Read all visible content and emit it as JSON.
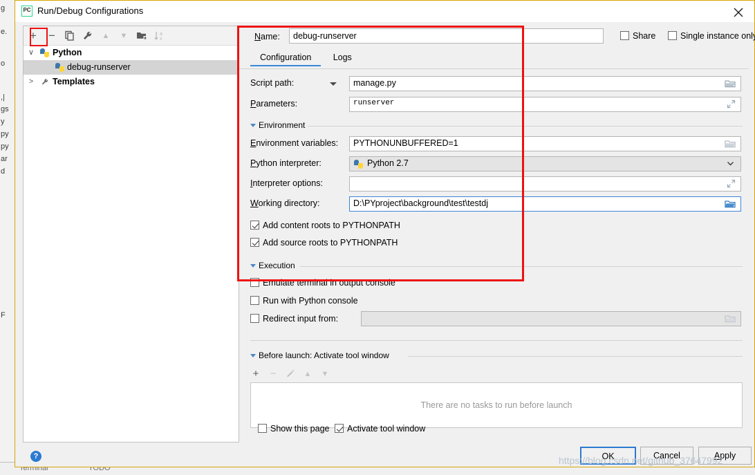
{
  "window": {
    "title": "Run/Debug Configurations",
    "app_icon": "pycharm-icon",
    "close_icon": "close-icon"
  },
  "background": {
    "left_fragments": [
      "g",
      "e.",
      "o",
      ",|",
      "gs",
      "y",
      "py",
      "py",
      "ar",
      "d",
      "F"
    ],
    "bottom_fragments": [
      "Terminal",
      "TODO"
    ]
  },
  "left_panel": {
    "toolbar": [
      {
        "name": "add-configuration-button",
        "glyph": "+",
        "dim": false,
        "highlighted": true
      },
      {
        "name": "remove-configuration-button",
        "glyph": "−",
        "dim": false,
        "highlighted": false
      },
      {
        "name": "copy-configuration-button",
        "glyph": "❐",
        "dim": false,
        "highlighted": false
      },
      {
        "name": "edit-templates-button",
        "glyph": "ὒ7",
        "dim": false,
        "highlighted": false
      },
      {
        "name": "move-up-button",
        "glyph": "▲",
        "dim": true,
        "highlighted": false
      },
      {
        "name": "move-down-button",
        "glyph": "▼",
        "dim": true,
        "highlighted": false
      },
      {
        "name": "new-folder-button",
        "glyph": "Ὄ1",
        "dim": false,
        "highlighted": false
      },
      {
        "name": "sort-alphabetically-button",
        "glyph": "⇣az",
        "dim": true,
        "highlighted": false
      }
    ],
    "tree": [
      {
        "label": "Python",
        "icon": "python-icon",
        "twisty": "∨",
        "depth": 0,
        "bold": true,
        "selected": false
      },
      {
        "label": "debug-runserver",
        "icon": "python-icon",
        "twisty": "",
        "depth": 1,
        "bold": false,
        "selected": true
      },
      {
        "label": "Templates",
        "icon": "wrench-icon",
        "twisty": ">",
        "depth": 0,
        "bold": true,
        "selected": false
      }
    ]
  },
  "right_panel": {
    "name_label": "Name:",
    "name_value": "debug-runserver",
    "share": {
      "label": "Share",
      "checked": false
    },
    "single_instance": {
      "label": "Single instance only",
      "checked": false
    },
    "tabs": [
      {
        "label": "Configuration",
        "active": true
      },
      {
        "label": "Logs",
        "active": false
      }
    ],
    "fields": [
      {
        "name": "script-path",
        "label": "Script path:",
        "value": "manage.py",
        "has_dropdown": true,
        "trailing_icon": "folder-browse-icon",
        "style": "normal"
      },
      {
        "name": "parameters",
        "label": "Parameters:",
        "value": "runserver",
        "has_dropdown": false,
        "trailing_icon": "expand-editor-icon",
        "style": "mono"
      },
      {
        "name": "environment-variables",
        "label": "Environment variables:",
        "value": "PYTHONUNBUFFERED=1",
        "has_dropdown": false,
        "trailing_icon": "folder-browse-icon",
        "style": "normal"
      },
      {
        "name": "python-interpreter",
        "label": "Python interpreter:",
        "value": "Python 2.7",
        "has_dropdown": false,
        "trailing_icon": "chevron-down-icon",
        "style": "grey",
        "value_icon": "python-icon"
      },
      {
        "name": "interpreter-options",
        "label": "Interpreter options:",
        "value": "",
        "has_dropdown": false,
        "trailing_icon": "expand-editor-icon",
        "style": "normal"
      },
      {
        "name": "working-directory",
        "label": "Working directory:",
        "value": "D:\\PYproject\\background\\test\\testdj",
        "has_dropdown": false,
        "trailing_icon": "folder-browse-icon",
        "style": "focus"
      }
    ],
    "sections": {
      "environment": "Environment",
      "execution": "Execution",
      "before_launch": "Before launch: Activate tool window"
    },
    "path_checkboxes": [
      {
        "name": "add-content-roots",
        "label": "Add content roots to PYTHONPATH",
        "checked": true
      },
      {
        "name": "add-source-roots",
        "label": "Add source roots to PYTHONPATH",
        "checked": true
      }
    ],
    "execution_checkboxes": [
      {
        "name": "emulate-terminal",
        "label": "Emulate terminal in output console",
        "checked": false
      },
      {
        "name": "run-with-python-console",
        "label": "Run with Python console",
        "checked": false
      },
      {
        "name": "redirect-input-from",
        "label": "Redirect input from:",
        "checked": false,
        "has_field": true,
        "field_value": ""
      }
    ],
    "before_launch": {
      "toolbar": [
        {
          "name": "add-task-button",
          "glyph": "+",
          "dim": false
        },
        {
          "name": "remove-task-button",
          "glyph": "−",
          "dim": true
        },
        {
          "name": "edit-task-button",
          "glyph": "✎",
          "dim": true
        },
        {
          "name": "move-task-up-button",
          "glyph": "▲",
          "dim": true
        },
        {
          "name": "move-task-down-button",
          "glyph": "▼",
          "dim": true
        }
      ],
      "empty_text": "There are no tasks to run before launch"
    },
    "footer_checkboxes": [
      {
        "name": "show-this-page",
        "label": "Show this page",
        "checked": false
      },
      {
        "name": "activate-tool-window",
        "label": "Activate tool window",
        "checked": true
      }
    ]
  },
  "buttons": {
    "ok": "OK",
    "cancel": "Cancel",
    "apply": "Apply",
    "help": "?"
  },
  "watermark": "https://blog.csdn.net/github_37647992",
  "colors": {
    "annotation_red": "#ee1111",
    "accent_blue": "#3a87d8",
    "dialog_bg": "#f0f0f0",
    "window_border": "#d8a400"
  }
}
